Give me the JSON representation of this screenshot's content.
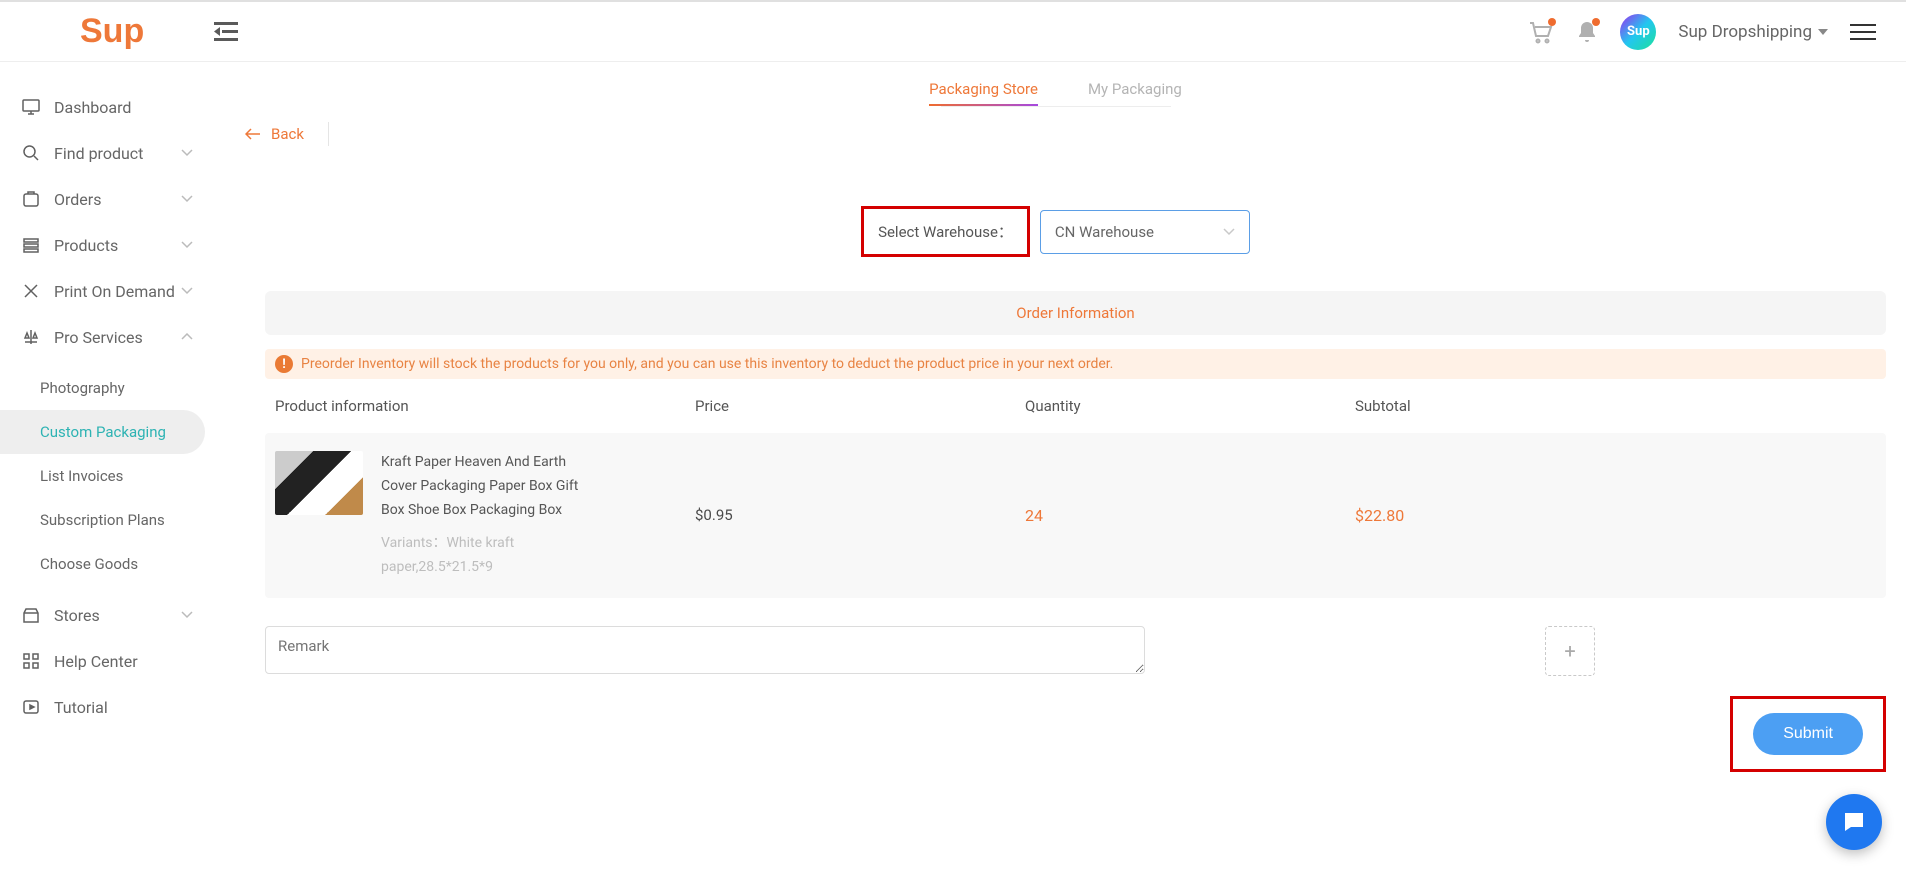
{
  "header": {
    "logo_text": "Sup",
    "user_label": "Sup Dropshipping",
    "avatar_text": "Sup"
  },
  "sidebar": {
    "items": [
      {
        "label": "Dashboard",
        "icon": "monitor",
        "expandable": false
      },
      {
        "label": "Find product",
        "icon": "search",
        "expandable": true
      },
      {
        "label": "Orders",
        "icon": "package",
        "expandable": true
      },
      {
        "label": "Products",
        "icon": "stack",
        "expandable": true
      },
      {
        "label": "Print On Demand",
        "icon": "tools",
        "expandable": true
      },
      {
        "label": "Pro Services",
        "icon": "scale",
        "expandable": true,
        "expanded": true,
        "children": [
          {
            "label": "Photography"
          },
          {
            "label": "Custom Packaging",
            "active": true
          },
          {
            "label": "List Invoices"
          },
          {
            "label": "Subscription Plans"
          },
          {
            "label": "Choose Goods"
          }
        ]
      },
      {
        "label": "Stores",
        "icon": "store",
        "expandable": true
      },
      {
        "label": "Help Center",
        "icon": "grid",
        "expandable": false
      },
      {
        "label": "Tutorial",
        "icon": "play",
        "expandable": false
      }
    ]
  },
  "tabs": {
    "packaging_store": "Packaging Store",
    "my_packaging": "My Packaging"
  },
  "back_label": "Back",
  "warehouse": {
    "label": "Select Warehouse：",
    "selected": "CN Warehouse"
  },
  "section": {
    "title": "Order Information"
  },
  "banner": {
    "text": "Preorder Inventory will stock the products for you only, and you can use this inventory to deduct the product price in your next order."
  },
  "table": {
    "headers": {
      "product": "Product information",
      "price": "Price",
      "quantity": "Quantity",
      "subtotal": "Subtotal"
    },
    "rows": [
      {
        "name": "Kraft Paper Heaven And Earth Cover Packaging Paper Box Gift Box Shoe Box Packaging Box",
        "variants_label": "Variants：",
        "variants_value": "White kraft paper,28.5*21.5*9",
        "price": "$0.95",
        "quantity": "24",
        "subtotal": "$22.80"
      }
    ]
  },
  "remark": {
    "placeholder": "Remark"
  },
  "actions": {
    "submit": "Submit"
  }
}
